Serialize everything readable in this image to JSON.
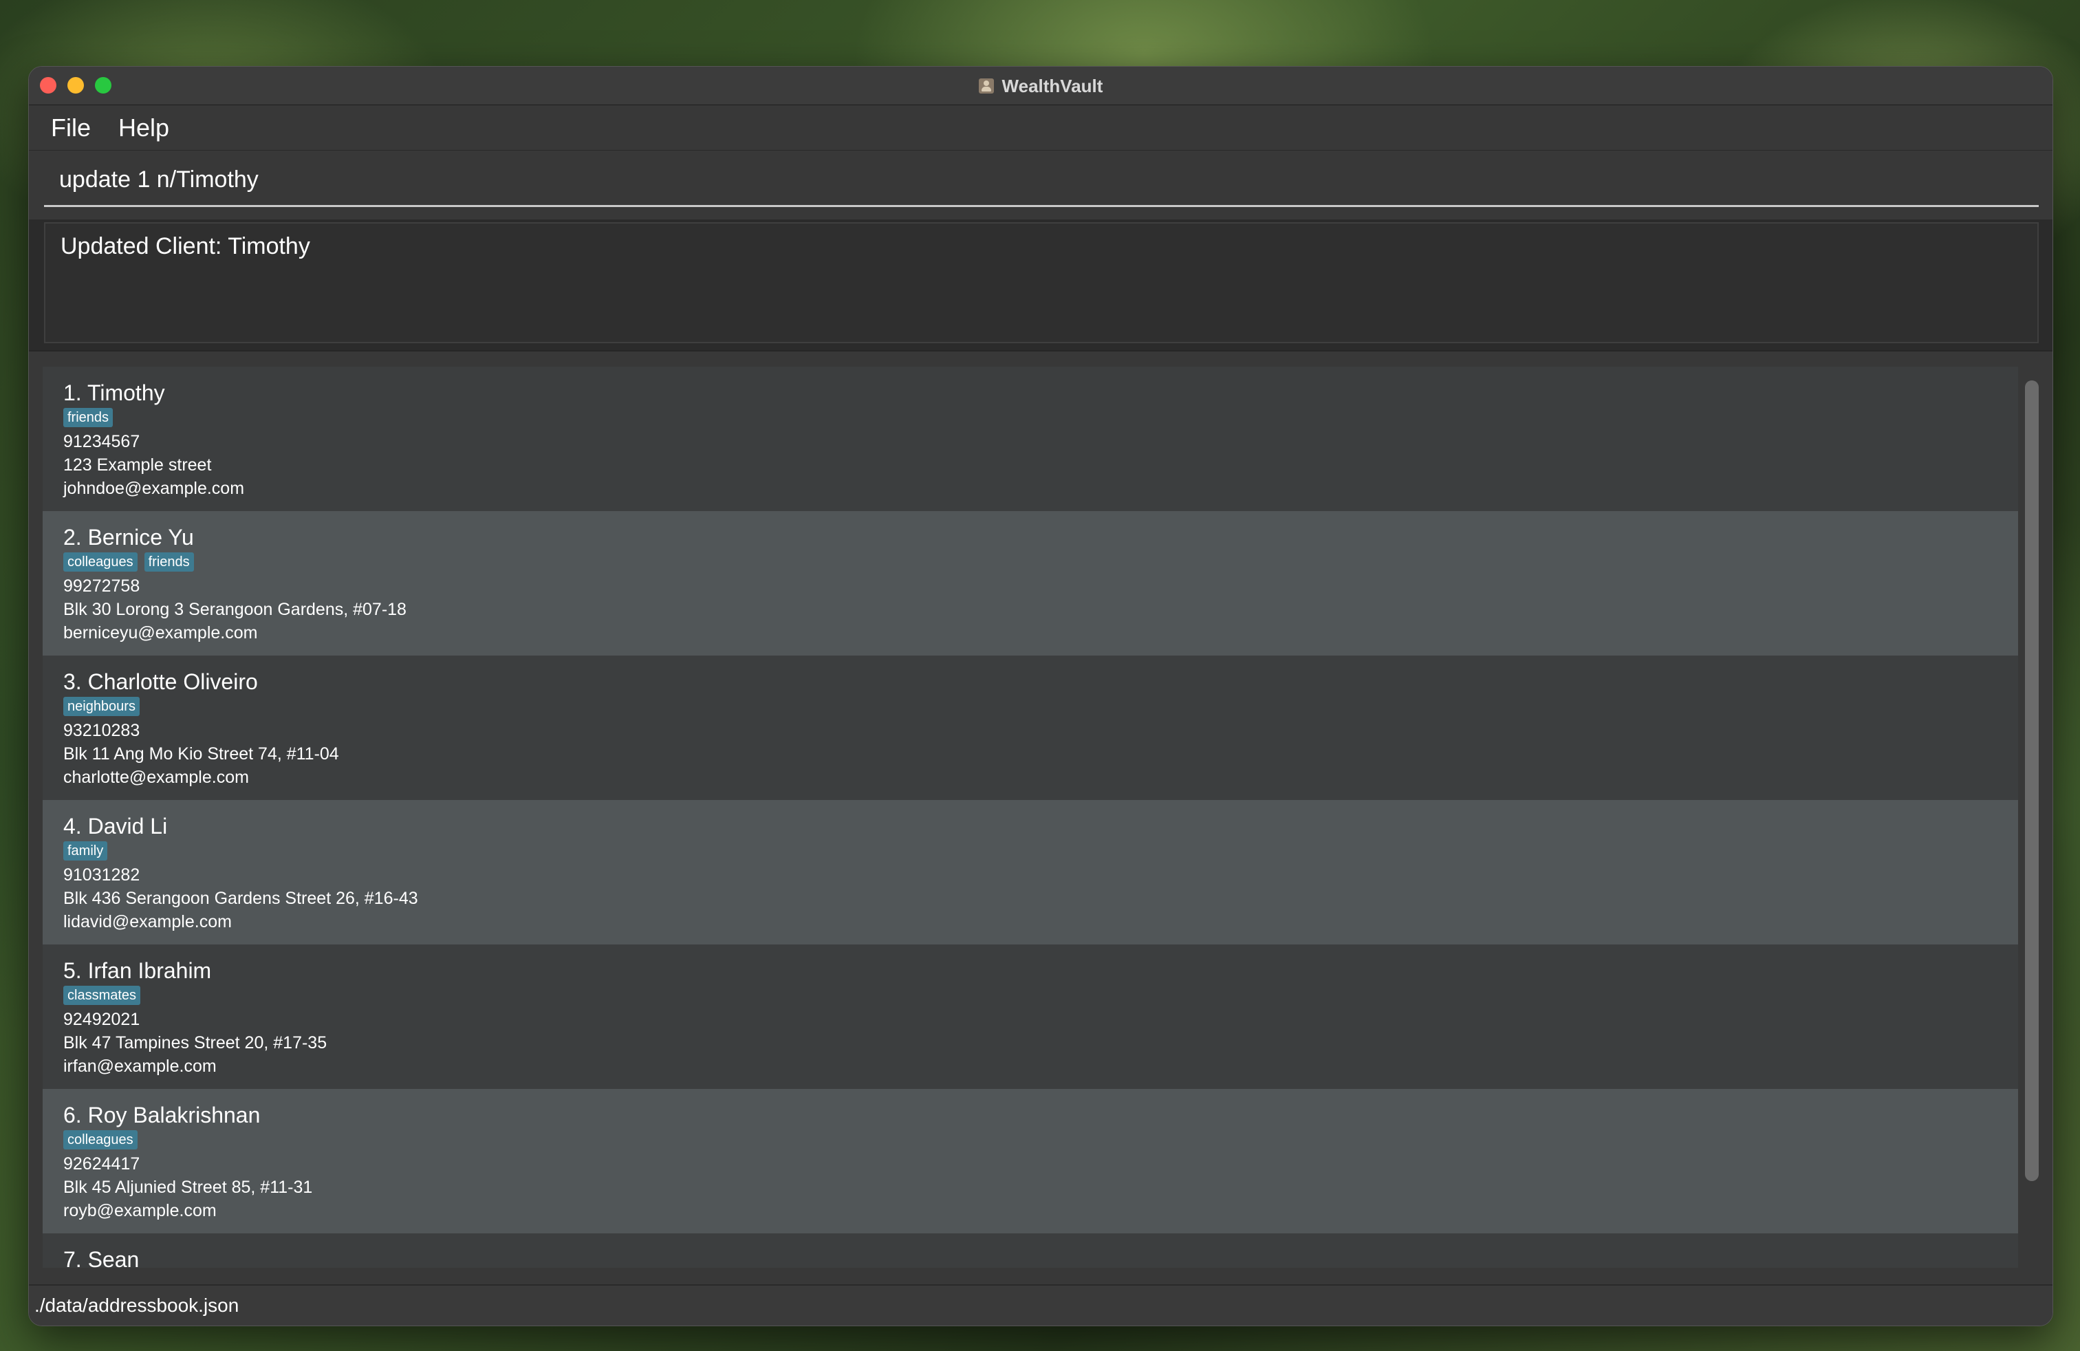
{
  "window": {
    "title": "WealthVault"
  },
  "menu": {
    "file": "File",
    "help": "Help"
  },
  "command": {
    "value": "update 1 n/Timothy"
  },
  "result": {
    "message": "Updated Client: Timothy"
  },
  "clients": [
    {
      "name": "1. Timothy",
      "tags": [
        "friends"
      ],
      "phone": "91234567",
      "address": "123 Example street",
      "email": "johndoe@example.com"
    },
    {
      "name": "2. Bernice Yu",
      "tags": [
        "colleagues",
        "friends"
      ],
      "phone": "99272758",
      "address": "Blk 30 Lorong 3 Serangoon Gardens, #07-18",
      "email": "berniceyu@example.com"
    },
    {
      "name": "3. Charlotte Oliveiro",
      "tags": [
        "neighbours"
      ],
      "phone": "93210283",
      "address": "Blk 11 Ang Mo Kio Street 74, #11-04",
      "email": "charlotte@example.com"
    },
    {
      "name": "4. David Li",
      "tags": [
        "family"
      ],
      "phone": "91031282",
      "address": "Blk 436 Serangoon Gardens Street 26, #16-43",
      "email": "lidavid@example.com"
    },
    {
      "name": "5. Irfan Ibrahim",
      "tags": [
        "classmates"
      ],
      "phone": "92492021",
      "address": "Blk 47 Tampines Street 20, #17-35",
      "email": "irfan@example.com"
    },
    {
      "name": "6. Roy Balakrishnan",
      "tags": [
        "colleagues"
      ],
      "phone": "92624417",
      "address": "Blk 45 Aljunied Street 85, #11-31",
      "email": "royb@example.com"
    },
    {
      "name": "7. Sean",
      "tags": [],
      "phone": "",
      "address": "",
      "email": ""
    }
  ],
  "status": {
    "file_path": "./data/addressbook.json"
  },
  "colors": {
    "tag": "#3e7b91",
    "card_odd": "#3c3e3f",
    "card_even": "#515658",
    "close": "#fe5f57",
    "minimize": "#febc2e",
    "maximize": "#28c840"
  }
}
